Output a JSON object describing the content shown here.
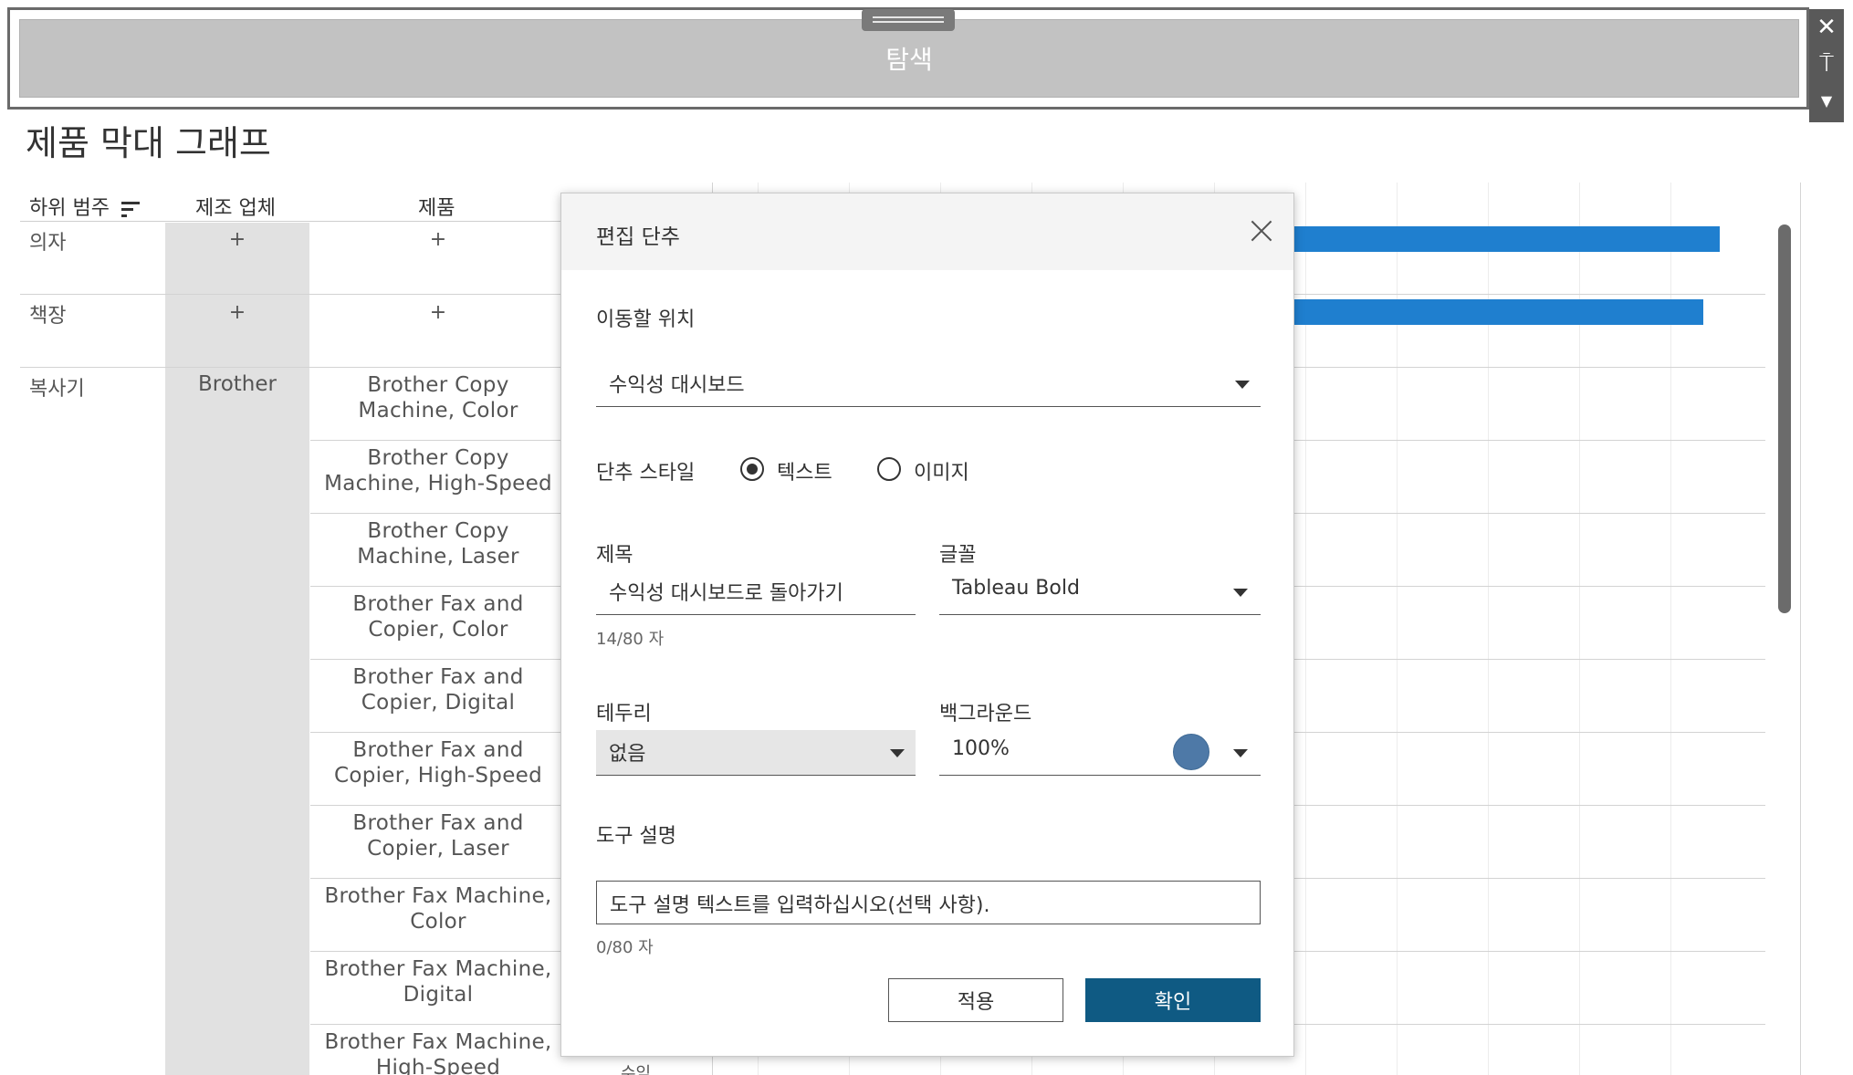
{
  "nav_button": {
    "label": "탐색"
  },
  "toolbar": {
    "close_icon": "close-icon",
    "pin_icon": "pin-icon",
    "menu_icon": "caret-down-icon",
    "pin_glyph": "⍑"
  },
  "sheet": {
    "title": "제품 막대 그래프",
    "headers": {
      "sub_category": "하위 범주",
      "manufacturer": "제조 업체",
      "product": "제품"
    },
    "categories": [
      "의자",
      "책장",
      "복사기"
    ],
    "plus": "+",
    "manufacturer": "Brother",
    "products": [
      [
        "Brother Copy",
        "Machine, Color"
      ],
      [
        "Brother Copy",
        "Machine, High-Speed"
      ],
      [
        "Brother Copy",
        "Machine, Laser"
      ],
      [
        "Brother Fax and",
        "Copier, Color"
      ],
      [
        "Brother Fax and",
        "Copier, Digital"
      ],
      [
        "Brother Fax and",
        "Copier, High-Speed"
      ],
      [
        "Brother Fax and",
        "Copier, Laser"
      ],
      [
        "Brother Fax Machine,",
        "Color"
      ],
      [
        "Brother Fax Machine,",
        "Digital"
      ],
      [
        "Brother Fax Machine,",
        "High-Speed"
      ]
    ],
    "stray_text": "수익",
    "bar_color": "#1f7fcf"
  },
  "dialog": {
    "title": "편집 단추",
    "navigate_label": "이동할 위치",
    "navigate_value": "수익성 대시보드",
    "style_label": "단추 스타일",
    "style_text": "텍스트",
    "style_image": "이미지",
    "title_label": "제목",
    "title_value": "수익성 대시보드로 돌아가기",
    "title_count": "14/80 자",
    "font_label": "글꼴",
    "font_value": "Tableau Bold",
    "border_label": "테두리",
    "border_value": "없음",
    "background_label": "백그라운드",
    "background_value": "100%",
    "background_color": "#4e79a7",
    "tooltip_label": "도구 설명",
    "tooltip_placeholder": "도구 설명 텍스트를 입력하십시오(선택 사항).",
    "tooltip_count": "0/80 자",
    "apply": "적용",
    "ok": "확인"
  }
}
